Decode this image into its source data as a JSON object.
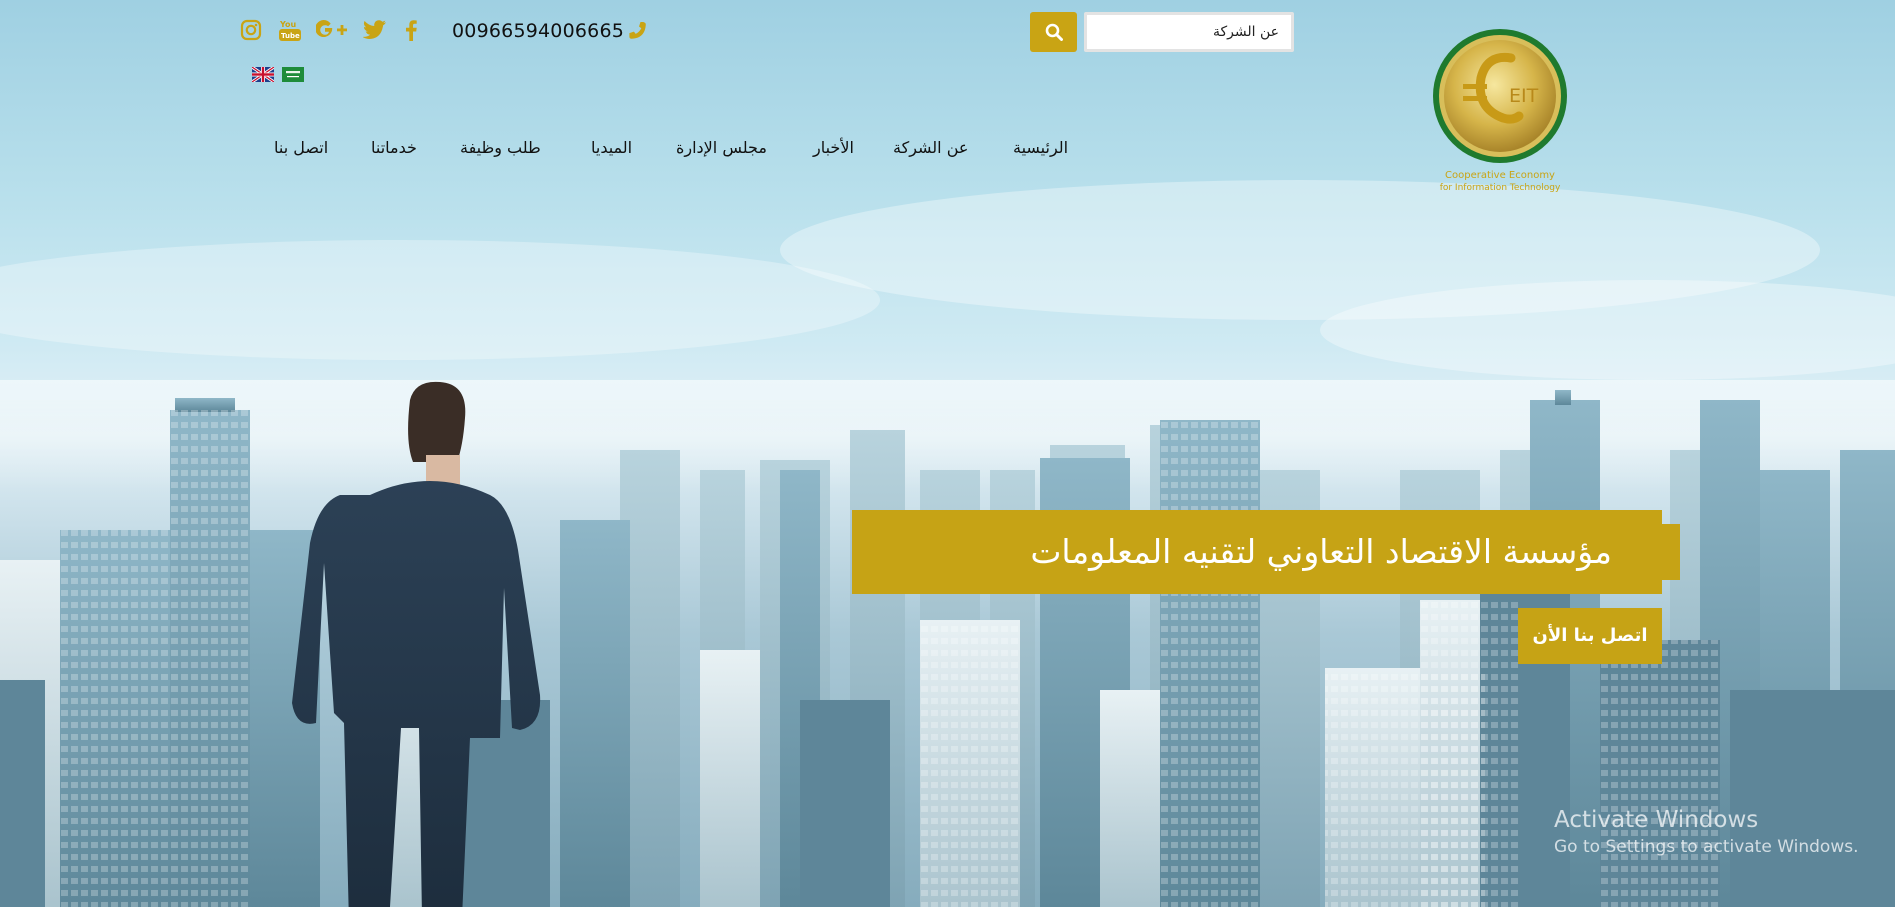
{
  "header": {
    "search": {
      "value": "عن الشركة",
      "placeholder": ""
    },
    "phone": "00966594006665",
    "social": [
      {
        "icon": "instagram-icon",
        "color": "#c9a414"
      },
      {
        "icon": "youtube-icon",
        "color": "#c9a414",
        "text": "You Tube"
      },
      {
        "icon": "google-plus-icon",
        "color": "#c9a414"
      },
      {
        "icon": "twitter-icon",
        "color": "#c9a414"
      },
      {
        "icon": "facebook-icon",
        "color": "#c9a414"
      }
    ],
    "languages": [
      {
        "icon": "uk-flag-icon",
        "lang": "English"
      },
      {
        "icon": "saudi-flag-icon",
        "lang": "Arabic"
      }
    ],
    "logo": {
      "mark": "EIT",
      "tagline_line1": "Cooperative Economy",
      "tagline_line2": "for Information Technology"
    }
  },
  "nav": {
    "items": [
      {
        "label": "الرئيسية"
      },
      {
        "label": "عن الشركة"
      },
      {
        "label": "الأخبار"
      },
      {
        "label": "مجلس الإدارة"
      },
      {
        "label": "الميديا"
      },
      {
        "label": "طلب وظيفة"
      },
      {
        "label": "خدماتنا"
      },
      {
        "label": "اتصل بنا"
      }
    ]
  },
  "hero": {
    "title": "مؤسسة الاقتصاد التعاوني لتقنيه المعلومات",
    "cta": "اتصل بنا الأن"
  },
  "watermark": {
    "line1": "Activate Windows",
    "line2": "Go to Settings to activate Windows."
  },
  "colors": {
    "accent": "#c6a315",
    "sky_top": "#9fd0e2",
    "text": "#111111"
  }
}
